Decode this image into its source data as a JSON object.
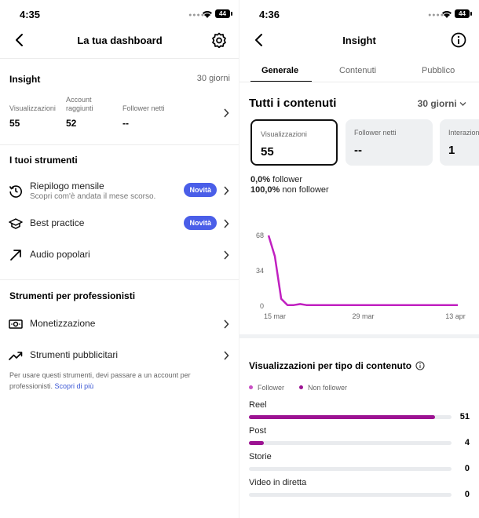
{
  "left": {
    "time": "4:35",
    "battery": "44",
    "title": "La tua dashboard",
    "insight": {
      "title": "Insight",
      "period": "30 giorni",
      "metrics": [
        {
          "label": "Visualizzazioni",
          "value": "55"
        },
        {
          "label": "Account raggiunti",
          "value": "52"
        },
        {
          "label": "Follower netti",
          "value": "--"
        }
      ]
    },
    "tools": {
      "title": "I tuoi strumenti",
      "items": [
        {
          "label": "Riepilogo mensile",
          "sub": "Scopri com'è andata il mese scorso.",
          "badge": "Novità",
          "icon": "history-icon"
        },
        {
          "label": "Best practice",
          "badge": "Novità",
          "icon": "graduation-cap-icon"
        },
        {
          "label": "Audio popolari",
          "icon": "trending-arrow-icon"
        }
      ]
    },
    "pro": {
      "title": "Strumenti per professionisti",
      "items": [
        {
          "label": "Monetizzazione",
          "icon": "money-icon"
        },
        {
          "label": "Strumenti pubblicitari",
          "icon": "chart-up-icon"
        }
      ],
      "note": "Per usare questi strumenti, devi passare a un account per professionisti.",
      "note_link": "Scopri di più"
    }
  },
  "right": {
    "time": "4:36",
    "battery": "44",
    "title": "Insight",
    "tabs": [
      "Generale",
      "Contenuti",
      "Pubblico"
    ],
    "section_title": "Tutti i contenuti",
    "period": "30 giorni",
    "cards": [
      {
        "label": "Visualizzazioni",
        "value": "55"
      },
      {
        "label": "Follower netti",
        "value": "--"
      },
      {
        "label": "Interazioni",
        "value": "1"
      }
    ],
    "follower_pct": "0,0%",
    "follower_label": "follower",
    "nonfollower_pct": "100,0%",
    "nonfollower_label": "non follower",
    "content_title": "Visualizzazioni per tipo di contenuto",
    "legend": {
      "follower": "Follower",
      "nonfollower": "Non follower"
    },
    "colors": {
      "follower": "#c94fc4",
      "nonfollower": "#9c1392",
      "line": "#c020c0"
    }
  },
  "chart_data": [
    {
      "type": "line",
      "x": [
        "14 mar",
        "15 mar",
        "16 mar",
        "17 mar",
        "18 mar",
        "19 mar",
        "20 mar",
        "21 mar",
        "22 mar",
        "23 mar",
        "24 mar",
        "25 mar",
        "26 mar",
        "27 mar",
        "28 mar",
        "29 mar",
        "30 mar",
        "31 mar",
        "1 apr",
        "2 apr",
        "3 apr",
        "4 apr",
        "5 apr",
        "6 apr",
        "7 apr",
        "8 apr",
        "9 apr",
        "10 apr",
        "11 apr",
        "12 apr",
        "13 apr"
      ],
      "values": [
        68,
        48,
        7,
        1,
        1,
        2,
        1,
        1,
        1,
        1,
        1,
        1,
        1,
        1,
        1,
        1,
        1,
        1,
        1,
        1,
        1,
        1,
        1,
        1,
        1,
        1,
        1,
        1,
        1,
        1,
        1
      ],
      "x_tick_labels": [
        "15 mar",
        "29 mar",
        "13 apr"
      ],
      "y_ticks": [
        0,
        34,
        68
      ],
      "ylim": [
        0,
        68
      ]
    },
    {
      "type": "bar",
      "categories": [
        "Reel",
        "Post",
        "Storie",
        "Video in diretta"
      ],
      "series": [
        {
          "name": "Follower",
          "values": [
            0,
            0,
            0,
            0
          ]
        },
        {
          "name": "Non follower",
          "values": [
            51,
            4,
            0,
            0
          ]
        }
      ],
      "totals": [
        51,
        4,
        0,
        0
      ]
    }
  ]
}
